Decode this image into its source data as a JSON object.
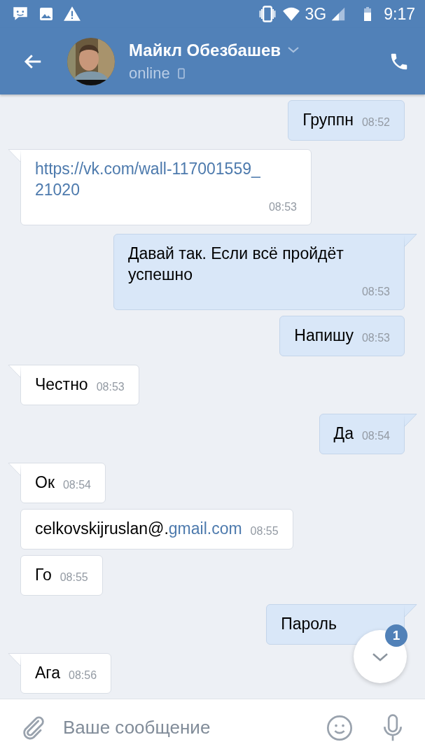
{
  "status_bar": {
    "network": "3G",
    "time": "9:17"
  },
  "header": {
    "name": "Майкл Обезбашев",
    "status": "online"
  },
  "messages": [
    {
      "outgoing": true,
      "text": "Группн",
      "time": "08:52",
      "tail": false
    },
    {
      "outgoing": false,
      "link": "https://vk.com/wall-117001559_21020",
      "time": "08:53",
      "tail": true
    },
    {
      "outgoing": true,
      "text": "Давай так. Если всё пройдёт успешно",
      "time": "08:53",
      "tail": true
    },
    {
      "outgoing": true,
      "text": "Напишу",
      "time": "08:53",
      "tail": false
    },
    {
      "outgoing": false,
      "text": "Честно",
      "time": "08:53",
      "tail": true
    },
    {
      "outgoing": true,
      "text": "Да",
      "time": "08:54",
      "tail": true
    },
    {
      "outgoing": false,
      "text": "Ок",
      "time": "08:54",
      "tail": true
    },
    {
      "outgoing": false,
      "text": "celkovskijruslan@.",
      "link": "gmail.com",
      "time": "08:55",
      "tail": false
    },
    {
      "outgoing": false,
      "text": "Го",
      "time": "08:55",
      "tail": false
    },
    {
      "outgoing": true,
      "text": "Пароль",
      "tail": true
    },
    {
      "outgoing": false,
      "text": "Ага",
      "time": "08:56",
      "tail": true
    }
  ],
  "scroll_button": {
    "badge": "1"
  },
  "composer": {
    "placeholder": "Ваше сообщение"
  }
}
